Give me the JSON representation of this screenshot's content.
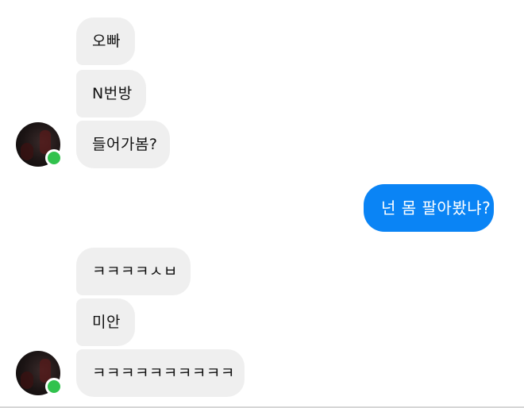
{
  "conversation": {
    "group1": {
      "messages": [
        "오빠",
        "N번방",
        "들어가봄?"
      ]
    },
    "reply": {
      "message": "넌 몸 팔아봤냐?"
    },
    "group2": {
      "messages": [
        "ㅋㅋㅋㅋㅅㅂ",
        "미안",
        "ㅋㅋㅋㅋㅋㅋㅋㅋㅋㅋ"
      ]
    }
  },
  "colors": {
    "incoming_bubble": "#efefef",
    "outgoing_bubble": "#0a84f5",
    "online_indicator": "#31c24d"
  },
  "icons": {
    "avatar": "avatar",
    "status": "online-status-icon"
  }
}
